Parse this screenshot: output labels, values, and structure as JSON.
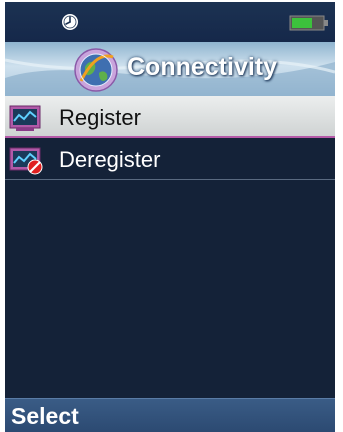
{
  "status_bar": {
    "left_icon": "alarm-clock-icon",
    "right_icon": "battery-icon",
    "battery_color": "#3cc13c"
  },
  "title_bar": {
    "title": "Connectivity",
    "icon": "connectivity-globe-icon"
  },
  "menu": {
    "items": [
      {
        "label": "Register",
        "icon": "register-device-icon",
        "selected": true
      },
      {
        "label": "Deregister",
        "icon": "deregister-device-icon",
        "selected": false
      }
    ]
  },
  "softkeys": {
    "left": "Select"
  },
  "colors": {
    "background": "#142238",
    "selection": "#e0e3e3",
    "selection_border": "#b55aa8",
    "softkey_bar": "#33557e"
  }
}
